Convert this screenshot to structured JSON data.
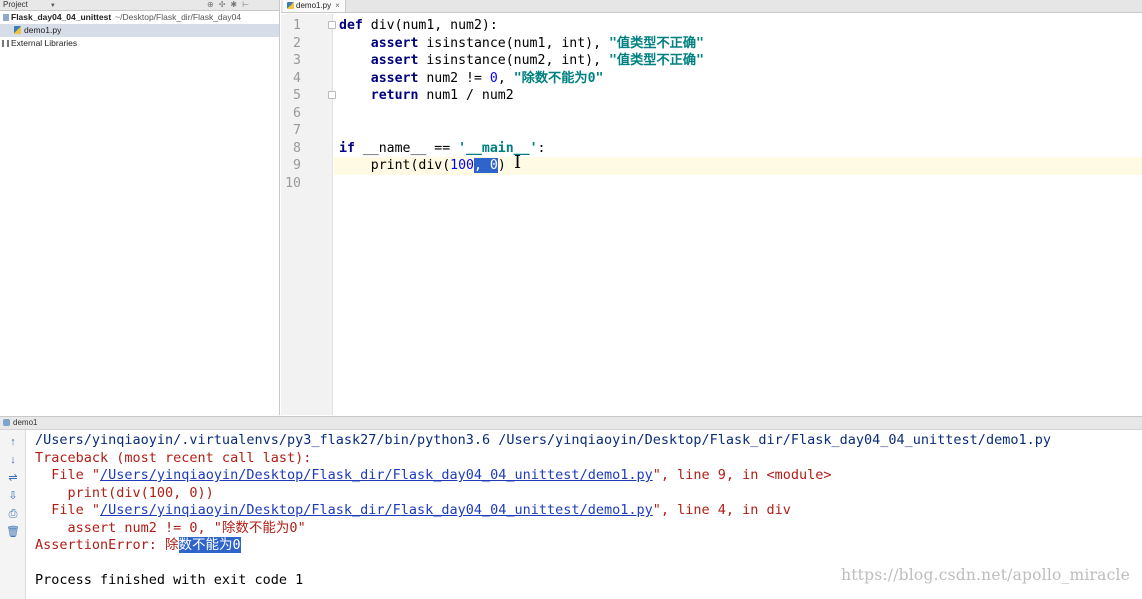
{
  "sidebar": {
    "header_label": "Project",
    "project_name": "Flask_day04_04_unittest",
    "project_path": "~/Desktop/Flask_dir/Flask_day04",
    "file_name": "demo1.py",
    "external_libraries": "External Libraries"
  },
  "editor": {
    "tab_label": "demo1.py",
    "close_glyph": "×",
    "line_numbers": [
      "1",
      "2",
      "3",
      "4",
      "5",
      "6",
      "7",
      "8",
      "9",
      "10"
    ],
    "lines": {
      "l1": {
        "kw": "def",
        "rest": " div(num1, num2):"
      },
      "l2": {
        "kw": "assert",
        "mid": " isinstance(num1, int), ",
        "str": "\"值类型不正确\""
      },
      "l3": {
        "kw": "assert",
        "mid": " isinstance(num2, int), ",
        "str": "\"值类型不正确\""
      },
      "l4": {
        "kw": "assert",
        "mid": " num2 != ",
        "num": "0",
        "mid2": ", ",
        "str": "\"除数不能为0\""
      },
      "l5": {
        "kw": "return",
        "rest": " num1 / num2"
      },
      "l8": {
        "kw": "if",
        "mid": " __name__ == ",
        "str": "'__main__'",
        "end": ":"
      },
      "l9": {
        "pre": "print(div(",
        "num": "100",
        "sel": ", 0",
        "end": ")"
      }
    }
  },
  "run": {
    "tab_label": "demo1",
    "console": {
      "cmd": "/Users/yinqiaoyin/.virtualenvs/py3_flask27/bin/python3.6 /Users/yinqiaoyin/Desktop/Flask_dir/Flask_day04_04_unittest/demo1.py",
      "traceback": "Traceback (most recent call last):",
      "file1_pre": "  File \"",
      "file1_link": "/Users/yinqiaoyin/Desktop/Flask_dir/Flask_day04_04_unittest/demo1.py",
      "file1_post": "\", line 9, in <module>",
      "code1": "    print(div(100, 0))",
      "file2_pre": "  File \"",
      "file2_link": "/Users/yinqiaoyin/Desktop/Flask_dir/Flask_day04_04_unittest/demo1.py",
      "file2_post": "\", line 4, in div",
      "code2": "    assert num2 != 0, \"除数不能为0\"",
      "error_pre": "AssertionError: 除",
      "error_sel": "数不能为0",
      "finish": "Process finished with exit code 1"
    },
    "toolbar_icons": [
      "arrow-up-icon",
      "arrow-down-icon",
      "soft-wrap-icon",
      "scroll-to-end-icon",
      "print-icon",
      "trash-icon"
    ]
  },
  "watermark": "https://blog.csdn.net/apollo_miracle",
  "colors": {
    "keyword": "#000080",
    "string": "#008080",
    "number": "#0000ff",
    "selection": "#2f65ca",
    "current_line": "#fffae3",
    "error_text": "#b01e16",
    "link": "#1e3bbd"
  }
}
